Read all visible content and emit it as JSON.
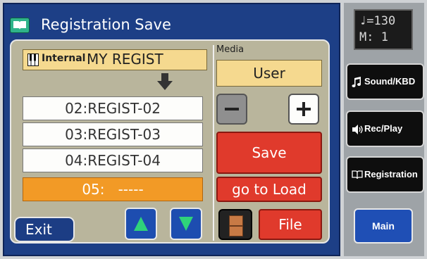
{
  "title": "Registration Save",
  "source": {
    "location": "Internal",
    "name": "MY REGIST"
  },
  "slots": [
    {
      "label": "02:REGIST-02"
    },
    {
      "label": "03:REGIST-03"
    },
    {
      "label": "04:REGIST-04"
    },
    {
      "label": "05:   -----",
      "selected": true
    }
  ],
  "media": {
    "label": "Media",
    "value": "User"
  },
  "buttons": {
    "save": "Save",
    "go_to_load": "go to Load",
    "file": "File",
    "exit": "Exit"
  },
  "tempo": {
    "line1": "♩=130",
    "line2": "M:  1"
  },
  "side_buttons": {
    "sound_kbd": "Sound/KBD",
    "rec_play": "Rec/Play",
    "registration": "Registration",
    "main": "Main"
  },
  "colors": {
    "panel": "#1d3f86",
    "content": "#b9b59c",
    "selected_slot": "#f29a26",
    "red_button": "#e03a2c",
    "accent_green": "#2fd37a"
  }
}
